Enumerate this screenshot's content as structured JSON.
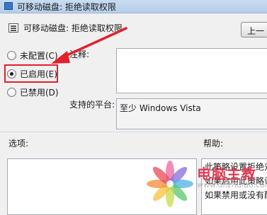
{
  "window": {
    "title": "可移动磁盘: 拒绝读取权限"
  },
  "header": {
    "policy_name": "可移动磁盘: 拒绝读取权限",
    "prev_button_label": "上一"
  },
  "radio_options": [
    {
      "label": "未配置(C)",
      "checked": false
    },
    {
      "label": "已启用(E)",
      "checked": true
    },
    {
      "label": "已禁用(D)",
      "checked": false
    }
  ],
  "fields": {
    "comment_label": "注释:",
    "comment_value": "",
    "platform_label": "支持的平台:",
    "platform_value": "至少 Windows Vista"
  },
  "sections": {
    "options_label": "选项:",
    "help_label": "帮助:"
  },
  "help_text": [
    "此策略设置拒绝对",
    "如果启用此策略设",
    "如果禁用或没有配"
  ],
  "annotation": {
    "highlight_color": "#e3202c"
  },
  "watermark": {
    "text": "电脑主教",
    "url": "www.dnzhuiao.com"
  }
}
